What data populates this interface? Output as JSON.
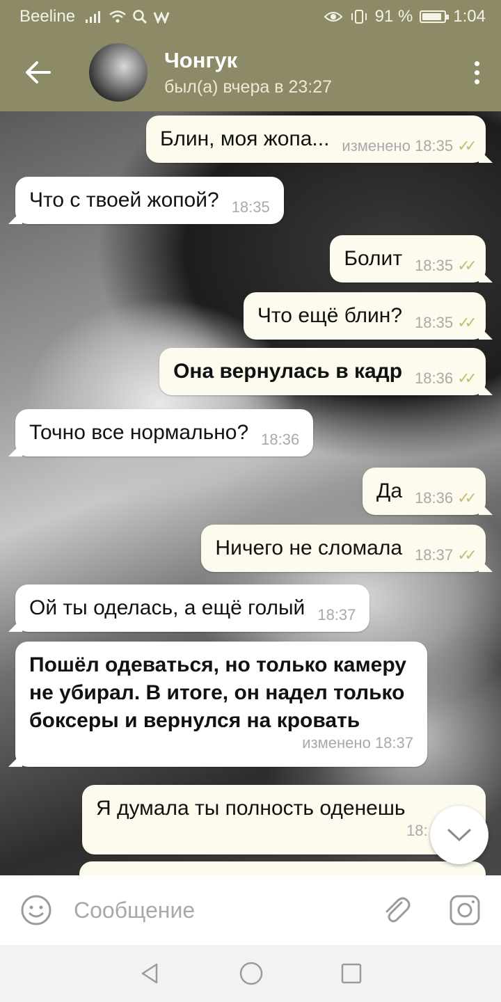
{
  "status_bar": {
    "carrier": "Beeline",
    "battery_text": "91 %",
    "battery_level": 0.91,
    "time": "1:04"
  },
  "header": {
    "contact_name": "Чонгук",
    "contact_status": "был(а) вчера в 23:27"
  },
  "messages": [
    {
      "dir": "out",
      "text": "Блин, моя жопа...",
      "edited": "изменено",
      "time": "18:35",
      "checks": "✓✓"
    },
    {
      "dir": "in",
      "text": "Что с твоей жопой?",
      "time": "18:35"
    },
    {
      "dir": "out",
      "text": "Болит",
      "time": "18:35",
      "checks": "✓✓"
    },
    {
      "dir": "out",
      "text": "Что ещё блин?",
      "time": "18:35",
      "checks": "✓✓"
    },
    {
      "dir": "out",
      "text": "Она вернулась в кадр",
      "time": "18:36",
      "checks": "✓✓"
    },
    {
      "dir": "in",
      "text": "Точно все нормально?",
      "time": "18:36"
    },
    {
      "dir": "out",
      "text": "Да",
      "time": "18:36",
      "checks": "✓✓"
    },
    {
      "dir": "out",
      "text": "Ничего не сломала",
      "time": "18:37",
      "checks": "✓✓"
    },
    {
      "dir": "in",
      "text": "Ой ты оделась, а ещё голый",
      "time": "18:37"
    },
    {
      "dir": "in",
      "text": "Пошёл одеваться, но только камеру не убирал. В итоге, он надел только боксеры и вернулся на кровать",
      "edited": "изменено",
      "time": "18:37"
    },
    {
      "dir": "out",
      "text": "Я думала ты полность оденешь",
      "time": "18:",
      "checks": ""
    }
  ],
  "input": {
    "placeholder": "Сообщение"
  },
  "icons": {
    "back": "arrow-left-icon",
    "menu": "more-vertical-icon",
    "emoji": "smile-icon",
    "attach": "paperclip-icon",
    "camera": "camera-icon",
    "scroll": "chevron-down-icon"
  },
  "colors": {
    "header_bg": "#8d8a68",
    "bubble_out": "#fdfbee",
    "bubble_in": "#ffffff",
    "checks": "#c9b97a"
  }
}
